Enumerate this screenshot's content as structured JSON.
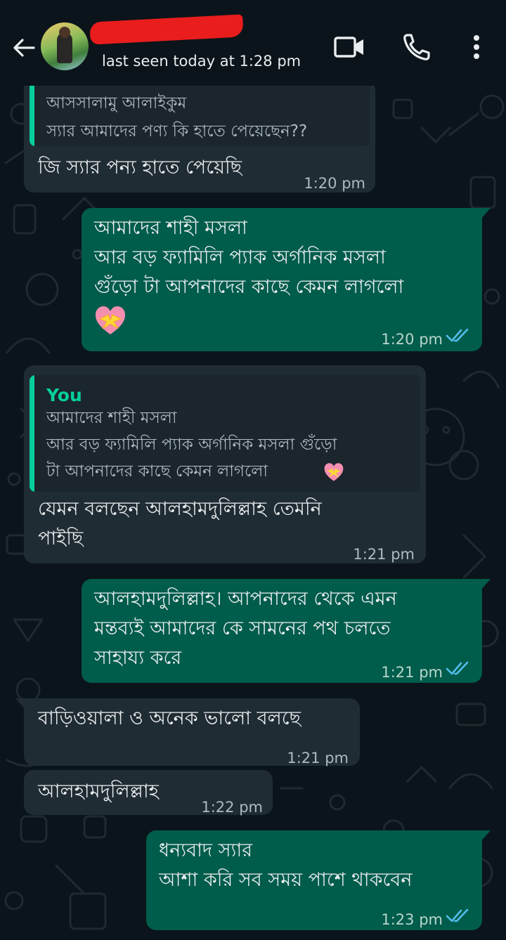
{
  "header": {
    "last_seen": "last seen today at 1:28 pm",
    "icons": [
      "back-arrow-icon",
      "avatar",
      "video-call-icon",
      "voice-call-icon",
      "more-options-icon"
    ]
  },
  "colors": {
    "background": "#0b141a",
    "incoming_bubble": "#202c33",
    "outgoing_bubble": "#005c4b",
    "quote_bar_green": "#06cf9c",
    "read_ticks": "#53bdeb",
    "redaction": "#ea1d1d"
  },
  "messages": [
    {
      "direction": "incoming",
      "quoted": {
        "line1": "আসসালামু আলাইকুম",
        "line2": "স্যার আমাদের পণ্য কি হাতে পেয়েছেন??"
      },
      "text": "জি স্যার পন্য হাতে পেয়েছি",
      "time": "1:20 pm"
    },
    {
      "direction": "outgoing",
      "text": "আমাদের শাহী মসলা\nআর বড় ফ্যামিলি প্যাক অর্গানিক মসলা\nগুঁড়ো টা আপনাদের কাছে কেমন লাগলো",
      "emoji": "heart-with-ribbon-icon",
      "time": "1:20 pm",
      "status": "read"
    },
    {
      "direction": "incoming",
      "quoted": {
        "name": "You",
        "text": "আমাদের শাহী মসলা\nআর বড় ফ্যামিলি প্যাক অর্গানিক মসলা গুঁড়ো\nটা আপনাদের কাছে কেমন লাগলো"
      },
      "text": "যেমন বলছেন আলহামদুলিল্লাহ তেমনি\nপাইছি",
      "time": "1:21 pm"
    },
    {
      "direction": "outgoing",
      "text": "আলহামদুলিল্লাহ। আপনাদের থেকে এমন\nমন্তব্যই আমাদের কে সামনের পথ চলতে\nসাহায্য করে",
      "time": "1:21 pm",
      "status": "read"
    },
    {
      "direction": "incoming",
      "text": "বাড়িওয়ালা ও অনেক ভালো বলছে",
      "time": "1:21 pm"
    },
    {
      "direction": "incoming",
      "text": "আলহামদুলিল্লাহ",
      "time": "1:22 pm"
    },
    {
      "direction": "outgoing",
      "text": "ধন্যবাদ স্যার\nআশা করি সব সময় পাশে থাকবেন",
      "time": "1:23 pm",
      "status": "read"
    }
  ]
}
